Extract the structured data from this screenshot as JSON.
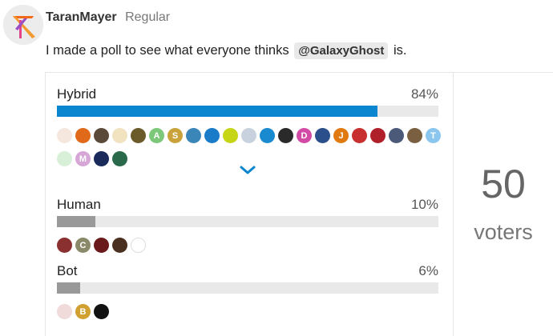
{
  "post": {
    "username": "TaranMayer",
    "user_title": "Regular",
    "text_before": "I made a poll to see what everyone thinks",
    "mention": "@GalaxyGhost",
    "text_after": "is."
  },
  "poll": {
    "options": [
      {
        "label": "Hybrid",
        "percent_text": "84%",
        "fraction": 0.84,
        "color": "#0a86d0",
        "voters": [
          {
            "letter": "",
            "color": "#f5e6de"
          },
          {
            "letter": "",
            "color": "#e06a1a"
          },
          {
            "letter": "",
            "color": "#5b4a3a"
          },
          {
            "letter": "",
            "color": "#f1e3c0"
          },
          {
            "letter": "",
            "color": "#6b5a2a"
          },
          {
            "letter": "A",
            "color": "#7cc77a"
          },
          {
            "letter": "S",
            "color": "#c9a23a"
          },
          {
            "letter": "",
            "color": "#3a86b8"
          },
          {
            "letter": "",
            "color": "#1a7bc8"
          },
          {
            "letter": "",
            "color": "#c6d617"
          },
          {
            "letter": "",
            "color": "#c8d2de"
          },
          {
            "letter": "",
            "color": "#1a8ad0"
          },
          {
            "letter": "",
            "color": "#2a2a2a"
          },
          {
            "letter": "D",
            "color": "#d24aa6"
          },
          {
            "letter": "",
            "color": "#2a4f8a"
          },
          {
            "letter": "J",
            "color": "#e07a10"
          },
          {
            "letter": "",
            "color": "#c83030"
          },
          {
            "letter": "",
            "color": "#b0202a"
          },
          {
            "letter": "",
            "color": "#4a5a78"
          },
          {
            "letter": "",
            "color": "#7a6040"
          },
          {
            "letter": "T",
            "color": "#8ac6ee"
          },
          {
            "letter": "",
            "color": "#d8f0d8"
          },
          {
            "letter": "M",
            "color": "#d6a6d6"
          },
          {
            "letter": "",
            "color": "#1a2a5a"
          },
          {
            "letter": "",
            "color": "#2a6a4a"
          }
        ]
      },
      {
        "label": "Human",
        "percent_text": "10%",
        "fraction": 0.1,
        "color": "#999999",
        "voters": [
          {
            "letter": "",
            "color": "#8a3030"
          },
          {
            "letter": "C",
            "color": "#8a8a6a"
          },
          {
            "letter": "",
            "color": "#6a1a1a"
          },
          {
            "letter": "",
            "color": "#4a3020"
          },
          {
            "letter": "",
            "color": "#ffffff"
          }
        ]
      },
      {
        "label": "Bot",
        "percent_text": "6%",
        "fraction": 0.06,
        "color": "#999999",
        "voters": [
          {
            "letter": "",
            "color": "#f0dada"
          },
          {
            "letter": "B",
            "color": "#d0a030"
          },
          {
            "letter": "",
            "color": "#111111"
          }
        ]
      }
    ],
    "voter_count": "50",
    "voter_label": "voters"
  }
}
